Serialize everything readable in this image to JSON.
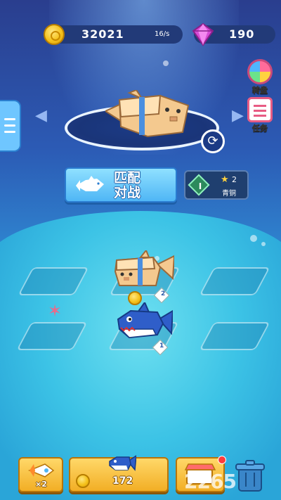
{
  "currency": {
    "coins": "32021",
    "rate": "16/s",
    "gems": "190"
  },
  "side_menu": {
    "wheel_label": "转盘",
    "task_label": "任务"
  },
  "match": {
    "label_line1": "匹配",
    "label_line2": "对战"
  },
  "rank": {
    "tier_roman": "I",
    "stars": "2",
    "name": "青铜"
  },
  "board": {
    "shark_level": "1",
    "pig_fish_level": "2"
  },
  "bottom_bar": {
    "rocket_count": "×2",
    "buy_price": "172"
  },
  "watermark": "2265",
  "colors": {
    "coin_gold": "#f5c21c",
    "button_orange": "#f2ae25",
    "match_blue": "#4fb6f5",
    "gem_pink": "#d64bd6"
  },
  "icons": [
    "menu-icon",
    "coin-icon",
    "gem-icon",
    "wheel-icon",
    "task-icon",
    "refresh-icon",
    "shark-icon",
    "rocket-icon",
    "shop-icon",
    "trash-icon",
    "star-icon"
  ]
}
